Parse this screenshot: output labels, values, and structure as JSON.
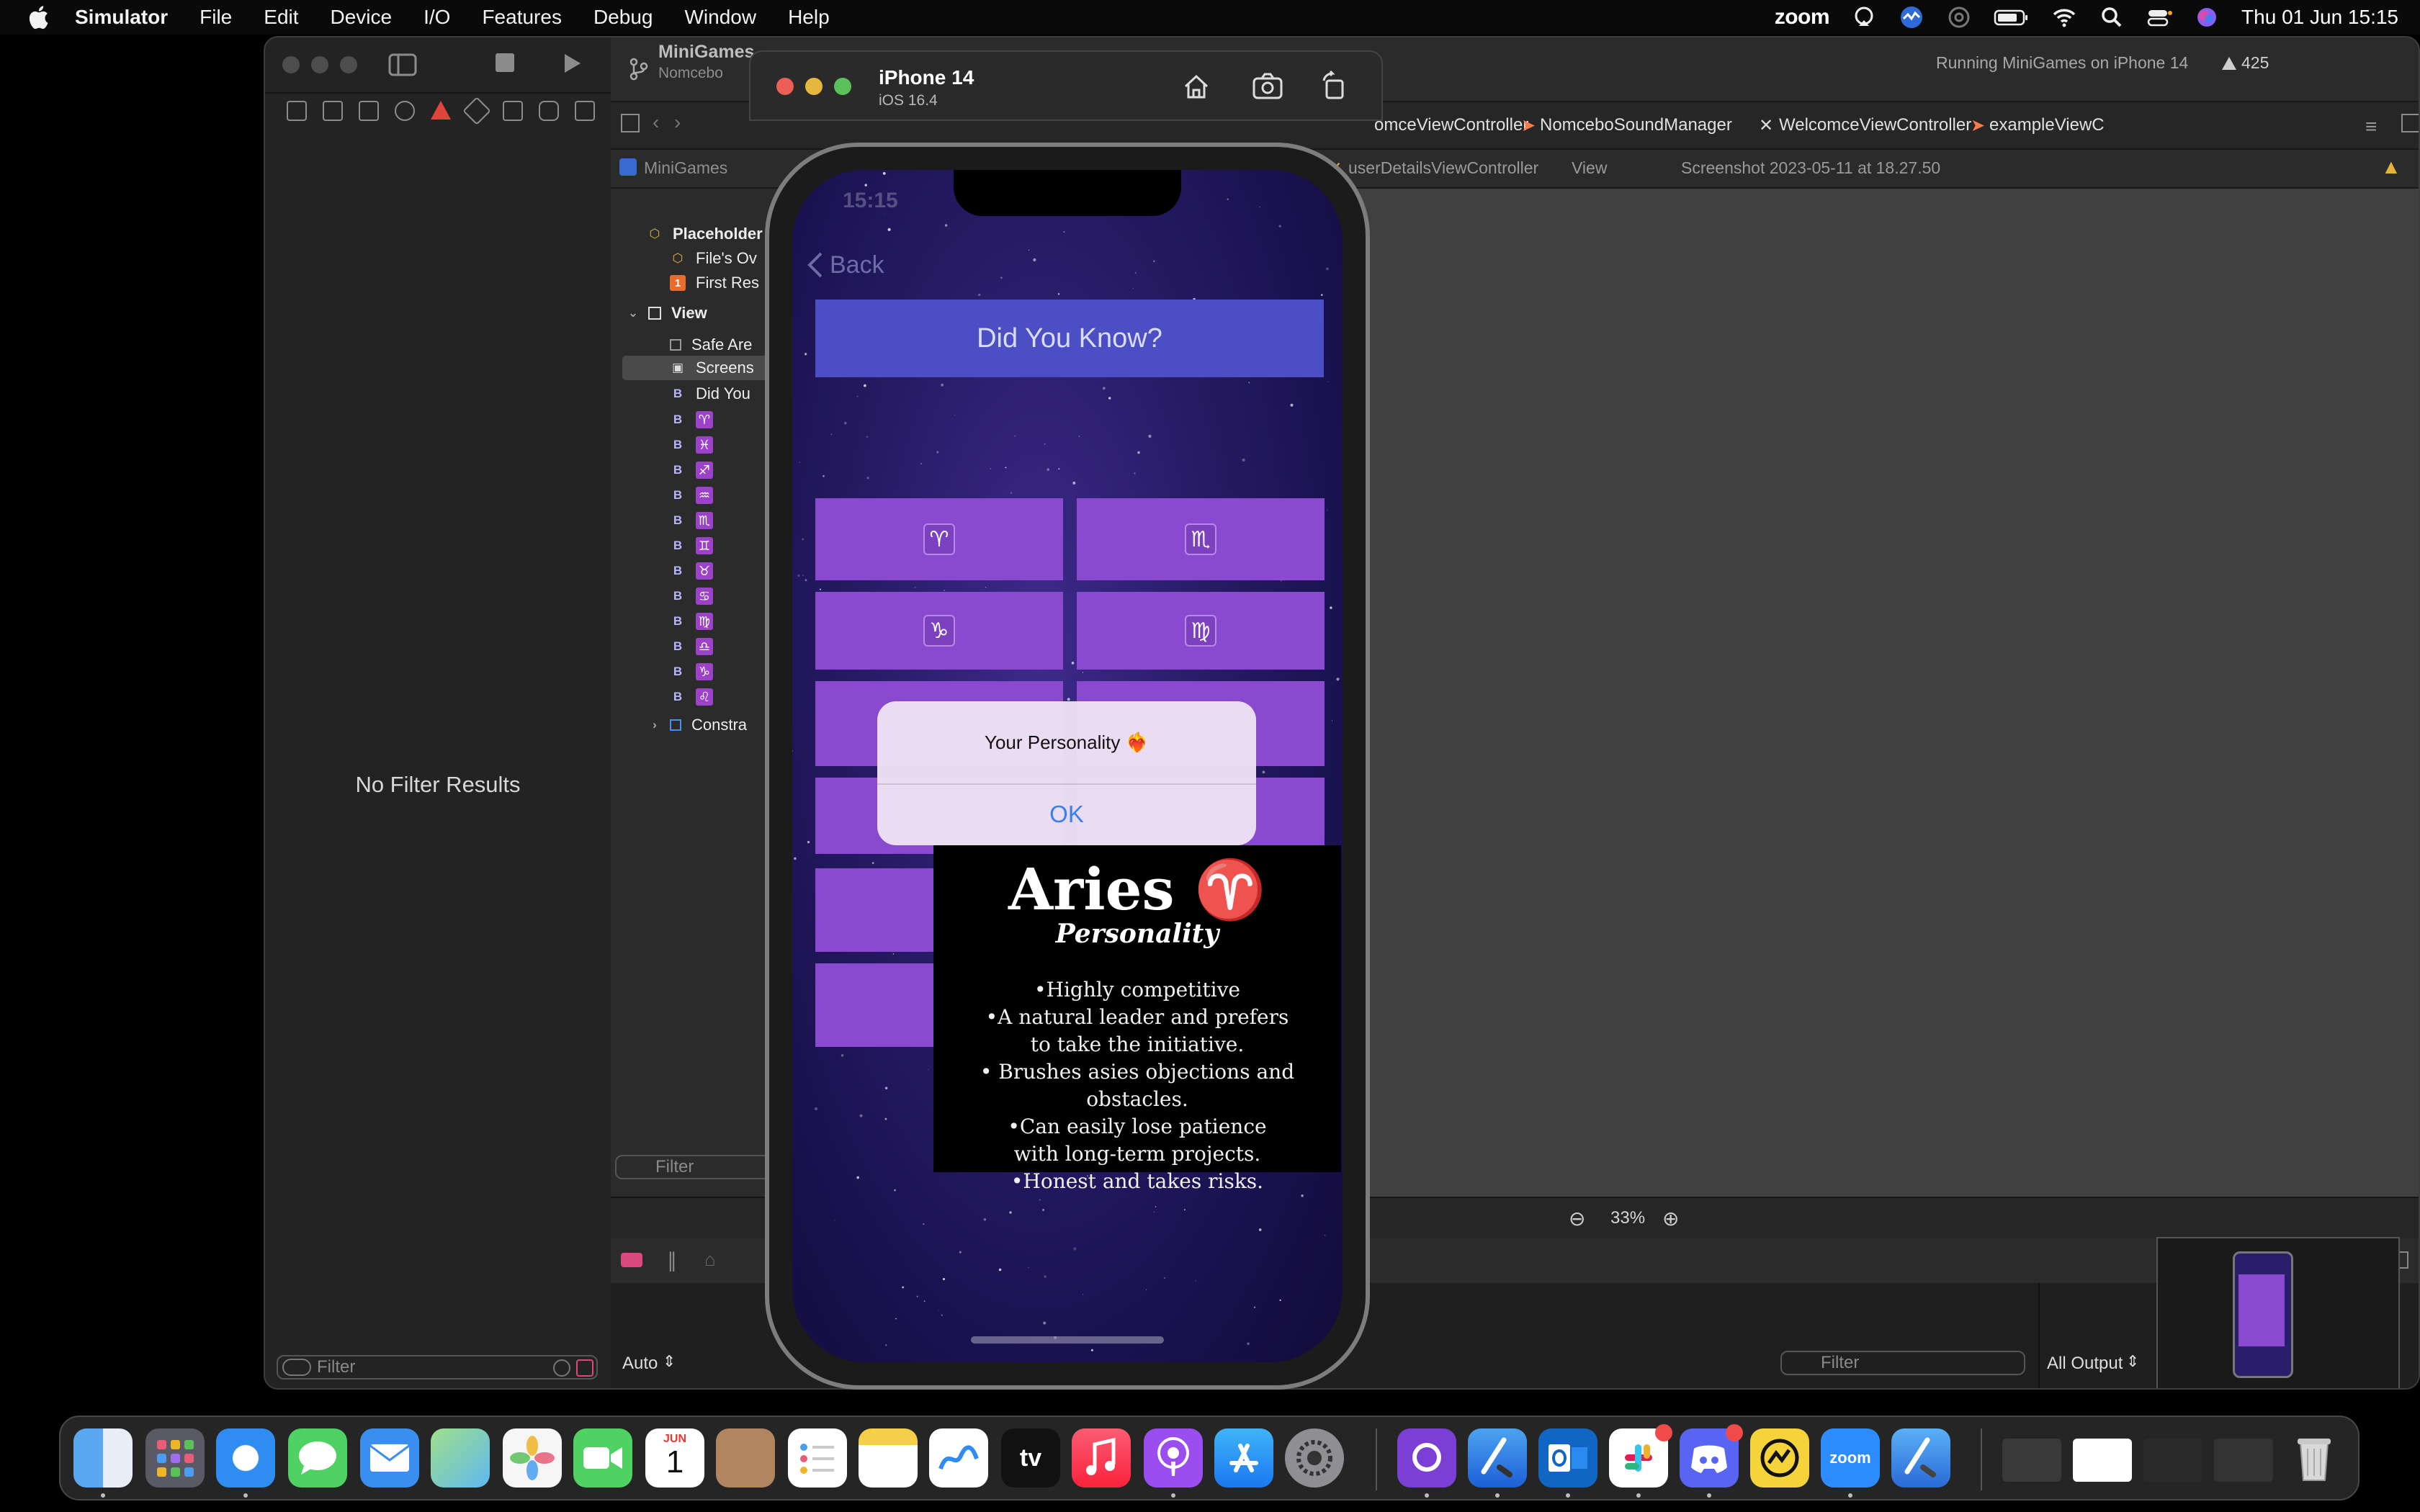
{
  "menubar": {
    "app_name": "Simulator",
    "items": [
      "File",
      "Edit",
      "Device",
      "I/O",
      "Features",
      "Debug",
      "Window",
      "Help"
    ],
    "zoom_label": "zoom",
    "datetime": "Thu 01 Jun  15:15"
  },
  "xcode": {
    "project_name": "MiniGames",
    "project_sub": "Nomcebo",
    "run_status": "Running MiniGames on iPhone 14",
    "warning_count": "425",
    "tabs": [
      "omceViewController",
      "NomceboSoundManager",
      "WelcomceViewController",
      "exampleViewC"
    ],
    "jump_bar": {
      "root": "MiniGames",
      "mid": "userDetailsViewController",
      "view": "View",
      "item": "Screenshot 2023-05-11 at 18.27.50"
    },
    "navigator": {
      "empty_text": "No Filter Results",
      "filter_placeholder": "Filter"
    },
    "outline": {
      "placeholders_label": "Placeholder",
      "files_owner": "File's Ov",
      "first_responder": "First Res",
      "view_label": "View",
      "safe_area": "Safe Are",
      "screenshot": "Screens",
      "did_you": "Did You",
      "zodiac_glyphs": [
        "♈",
        "♓",
        "♐",
        "♒",
        "♏",
        "♊",
        "♉",
        "♋",
        "♍",
        "♎",
        "♑",
        "♌"
      ],
      "constraints": "Constra",
      "filter_placeholder": "Filter"
    },
    "canvas": {
      "zoom_level": "33%"
    },
    "debug": {
      "auto_label": "Auto",
      "filter_placeholder": "Filter",
      "output_label": "All Output"
    }
  },
  "simulator": {
    "device_name": "iPhone 14",
    "os_version": "iOS 16.4"
  },
  "app": {
    "status_time": "15:15",
    "back_label": "Back",
    "title": "Did You Know?",
    "zodiac_buttons": [
      {
        "glyph": "♈",
        "name": "aries"
      },
      {
        "glyph": "♏",
        "name": "scorpio"
      },
      {
        "glyph": "♑",
        "name": "capricorn"
      },
      {
        "glyph": "♍",
        "name": "virgo"
      },
      {
        "glyph": "♐",
        "name": "sagittarius"
      },
      {
        "glyph": "♊",
        "name": "gemini"
      }
    ],
    "alert": {
      "message": "Your Personality",
      "emoji": "❤️‍🔥",
      "ok_label": "OK"
    },
    "aries_image": {
      "title": "Aries ♈",
      "subtitle": "Personality",
      "bullets": [
        "•Highly competitive",
        "•A natural leader and prefers",
        "to take the initiative.",
        "• Brushes asies objections and obstacles.",
        "•Can easily lose patience",
        "with long-term projects.",
        "•Honest and takes risks."
      ]
    }
  },
  "dock": {
    "calendar_month": "JUN",
    "calendar_day": "1",
    "tv_label": "tv",
    "zoom_label": "zoom",
    "apps": [
      "Finder",
      "Launchpad",
      "Safari",
      "Messages",
      "Mail",
      "Maps",
      "Photos",
      "FaceTime",
      "Calendar",
      "Contacts",
      "Reminders",
      "Notes",
      "Freeform",
      "TV",
      "Music",
      "Podcasts",
      "App Store",
      "System Settings",
      "GitHub Desktop",
      "Xcode",
      "Outlook",
      "Slack",
      "Discord",
      "Miro",
      "Zoom",
      "Xcode Dev",
      "Trash"
    ]
  }
}
